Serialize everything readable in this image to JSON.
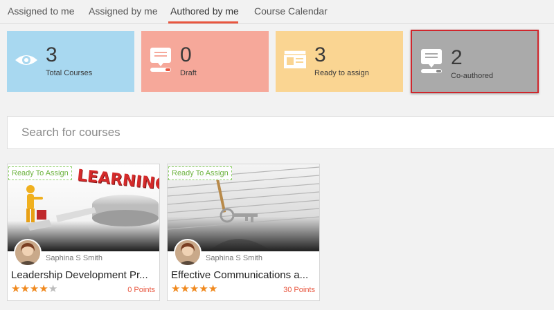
{
  "tabs": [
    {
      "label": "Assigned to me"
    },
    {
      "label": "Assigned by me"
    },
    {
      "label": "Authored by me"
    },
    {
      "label": "Course Calendar"
    }
  ],
  "active_tab": "Authored by me",
  "stats": [
    {
      "count": "3",
      "label": "Total Courses",
      "color": "#a8d8f0",
      "icon": "eye-icon"
    },
    {
      "count": "0",
      "label": "Draft",
      "color": "#f6a89a",
      "icon": "draft-icon"
    },
    {
      "count": "3",
      "label": "Ready to assign",
      "color": "#fad592",
      "icon": "ready-to-assign-icon"
    },
    {
      "count": "2",
      "label": "Co-authored",
      "color": "#aaaaaa",
      "icon": "co-authored-icon",
      "highlight_color": "#d0262c"
    }
  ],
  "search": {
    "placeholder": "Search for courses"
  },
  "courses": [
    {
      "badge": "Ready To Assign",
      "author": "Saphina S Smith",
      "title": "Leadership Development Pr...",
      "rating": 4,
      "max_rating": 5,
      "points": "0 Points",
      "thumb_word": "LEARNING"
    },
    {
      "badge": "Ready To Assign",
      "author": "Saphina S Smith",
      "title": "Effective Communications a...",
      "rating": 5,
      "max_rating": 5,
      "points": "30 Points"
    }
  ],
  "colors": {
    "accent": "#e8563f",
    "star": "#f0891e",
    "badge_green": "#6db33f"
  }
}
